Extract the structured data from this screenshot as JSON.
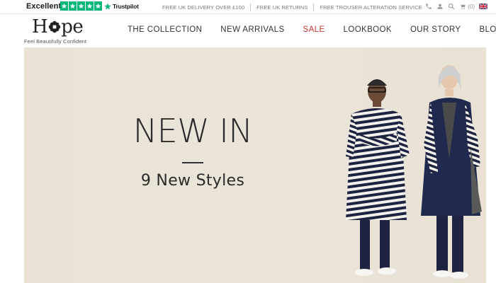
{
  "topbar": {
    "rating_label": "Excellent",
    "trustpilot_label": "Trustpilot",
    "stars_count": 5,
    "trustpilot_color": "#00b67a",
    "promos": [
      "FREE UK DELIVERY OVER £100",
      "FREE UK RETURNS",
      "FREE TROUSER ALTERATION SERVICE"
    ],
    "utility": {
      "icons": [
        "phone-icon",
        "account-icon",
        "search-icon",
        "cart-icon",
        "uk-flag-icon"
      ],
      "cart_count": "(0)"
    }
  },
  "header": {
    "logo_text_left": "H",
    "logo_text_right": "pe",
    "tagline": "Feel Beautifully Confident",
    "nav": [
      {
        "label": "THE COLLECTION"
      },
      {
        "label": "NEW ARRIVALS"
      },
      {
        "label": "SALE",
        "color": "#c8342f"
      },
      {
        "label": "LOOKBOOK"
      },
      {
        "label": "OUR STORY"
      },
      {
        "label": "BLOG"
      }
    ]
  },
  "hero": {
    "title": "NEW IN",
    "subtitle": "9 New Styles"
  }
}
